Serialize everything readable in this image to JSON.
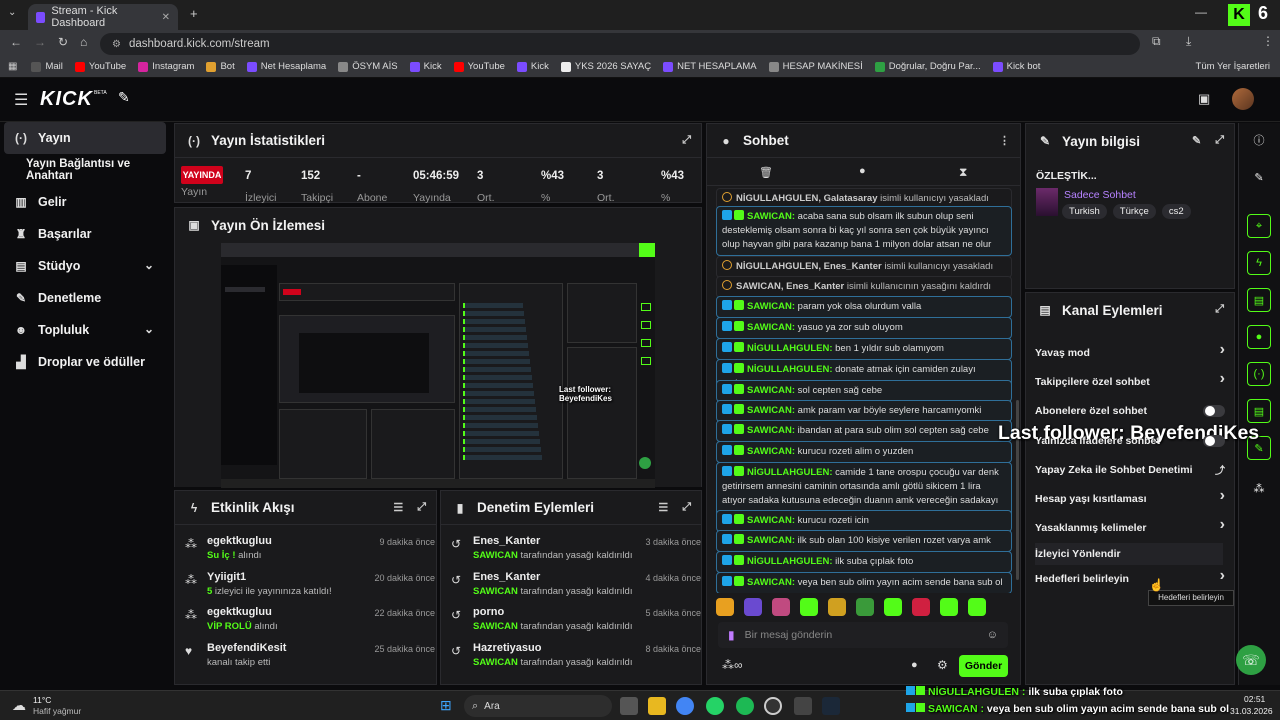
{
  "browser": {
    "tab_title": "Stream - Kick Dashboard",
    "url": "dashboard.kick.com/stream",
    "bookmarks": [
      "Mail",
      "YouTube",
      "Instagram",
      "Bot",
      "Net Hesaplama",
      "ÖSYM AİS",
      "Kick",
      "YouTube",
      "Kick",
      "YKS 2026 SAYAÇ",
      "NET HESAPLAMA",
      "HESAP MAKİNESİ",
      "Doğrular, Doğru Par...",
      "Kick bot"
    ],
    "bookmarks_all": "Tüm Yer İşaretleri",
    "bookmark_colors": [
      "#555",
      "#ff0000",
      "#d6249f",
      "#e0a030",
      "#7b4cff",
      "#888",
      "#7b4cff",
      "#ff0000",
      "#7b4cff",
      "#eee",
      "#7b4cff",
      "#888",
      "#2ea043",
      "#7b4cff"
    ]
  },
  "header": {
    "logo": "KICK",
    "beta": "BETA"
  },
  "sidebar": {
    "items": [
      {
        "label": "Yayın",
        "icon": "broadcast-icon"
      },
      {
        "label": "Yayın Bağlantısı ve Anahtarı",
        "icon": ""
      },
      {
        "label": "Gelir",
        "icon": "chart-icon"
      },
      {
        "label": "Başarılar",
        "icon": "trophy-icon"
      },
      {
        "label": "Stüdyo",
        "icon": "studio-icon"
      },
      {
        "label": "Denetleme",
        "icon": "wrench-icon"
      },
      {
        "label": "Topluluk",
        "icon": "people-icon"
      },
      {
        "label": "Droplar ve ödüller",
        "icon": "gift-icon"
      }
    ]
  },
  "stats": {
    "title": "Yayın İstatistikleri",
    "live_badge": "YAYINDA",
    "live_label": "Yayın",
    "columns": [
      {
        "value": "7",
        "label": "İzleyici"
      },
      {
        "value": "152",
        "label": "Takipçi"
      },
      {
        "value": "-",
        "label": "Abone"
      },
      {
        "value": "05:46:59",
        "label": "Yayında"
      },
      {
        "value": "3",
        "label": "Ort."
      },
      {
        "value": "%43",
        "label": "%"
      },
      {
        "value": "3",
        "label": "Ort."
      },
      {
        "value": "%43",
        "label": "%"
      }
    ]
  },
  "preview": {
    "title": "Yayın Ön İzlemesi",
    "overlay_text": "Last follower: BeyefendiKes"
  },
  "activity": {
    "title": "Etkinlik Akışı",
    "items": [
      {
        "name": "egektkugluu",
        "detail_b": "Su İç !",
        "detail": " alındı",
        "time": "9 dakika önce"
      },
      {
        "name": "Yyiigit1",
        "detail_b": "5",
        "detail": " izleyici ile yayınınıza katıldı!",
        "time": "20 dakika önce"
      },
      {
        "name": "egektkugluu",
        "detail_b": "VİP ROLÜ",
        "detail": " alındı",
        "time": "22 dakika önce"
      },
      {
        "name": "BeyefendiKesit",
        "detail_b": "",
        "detail": "kanalı takip etti",
        "time": "25 dakika önce"
      }
    ]
  },
  "moderation": {
    "title": "Denetim Eylemleri",
    "items": [
      {
        "name": "Enes_Kanter",
        "detail_b": "SAWICAN",
        "detail": " tarafından yasağı kaldırıldı",
        "time": "3 dakika önce"
      },
      {
        "name": "Enes_Kanter",
        "detail_b": "SAWICAN",
        "detail": " tarafından yasağı kaldırıldı",
        "time": "4 dakika önce"
      },
      {
        "name": "porno",
        "detail_b": "SAWICAN",
        "detail": " tarafından yasağı kaldırıldı",
        "time": "5 dakika önce"
      },
      {
        "name": "Hazretiyasuo",
        "detail_b": "SAWICAN",
        "detail": " tarafından yasağı kaldırıldı",
        "time": "8 dakika önce"
      }
    ]
  },
  "chat": {
    "title": "Sohbet",
    "messages": [
      {
        "type": "sys",
        "user": "NİGULLAHGULEN, Galatasaray",
        "text": " isimli kullanıcıyı yasakladı"
      },
      {
        "type": "msg",
        "user": "SAWICAN:",
        "text": " acaba sana sub olsam ilk subun olup seni desteklemiş olsam sonra bi kaç yıl sonra sen çok büyük yayıncı olup hayvan gibi para kazanıp bana 1 milyon dolar atsan ne olur"
      },
      {
        "type": "sys",
        "user": "NİGULLAHGULEN, Enes_Kanter",
        "text": " isimli kullanıcıyı yasakladı"
      },
      {
        "type": "sys",
        "user": "SAWICAN, Enes_Kanter",
        "text": " isimli kullanıcının yasağını kaldırdı"
      },
      {
        "type": "msg",
        "user": "SAWICAN:",
        "text": " param yok olsa olurdum valla"
      },
      {
        "type": "msg",
        "user": "SAWICAN:",
        "text": " yasuo ya zor sub oluyom"
      },
      {
        "type": "msg",
        "user": "NİGULLAHGULEN:",
        "text": " ben 1 yıldır sub olamıyom"
      },
      {
        "type": "msg",
        "user": "NİGULLAHGULEN:",
        "text": " donate atmak için camiden zulayı patlattım"
      },
      {
        "type": "msg",
        "user": "SAWICAN:",
        "text": " sol cepten sağ cebe"
      },
      {
        "type": "msg",
        "user": "SAWICAN:",
        "text": " amk param var böyle seylere harcamıyomki"
      },
      {
        "type": "msg",
        "user": "SAWICAN:",
        "text": " ibandan at para sub olim sol cepten sağ cebe"
      },
      {
        "type": "msg",
        "user": "SAWICAN:",
        "text": " kurucu rozeti alim o yuzden"
      },
      {
        "type": "msg",
        "user": "NİGULLAHGULEN:",
        "text": " camide 1 tane orospu çocuğu var denk getirirsem annesini caminin ortasında amlı götlü sikicem 1 lira atıyor sadaka kutusuna edeceğin duanın amk vereceğin sadakayı sikim"
      },
      {
        "type": "msg",
        "user": "SAWICAN:",
        "text": " kurucu rozeti icin"
      },
      {
        "type": "msg",
        "user": "SAWICAN:",
        "text": " ilk sub olan 100 kisiye verilen rozet varya amk"
      },
      {
        "type": "msg",
        "user": "NİGULLAHGULEN:",
        "text": " ilk suba çıplak foto"
      },
      {
        "type": "msg",
        "user": "SAWICAN:",
        "text": " veya ben sub olim yayın acim sende bana sub ol"
      }
    ],
    "input_placeholder": "Bir mesaj gönderin",
    "send_label": "Gönder"
  },
  "stream_info": {
    "title": "Yayın bilgisi",
    "stream_title": "ÖZLEŞTİK...",
    "category": "Sadece Sohbet",
    "tags": [
      "Turkish",
      "Türkçe",
      "cs2"
    ]
  },
  "channel_actions": {
    "title": "Kanal Eylemleri",
    "items": [
      {
        "label": "Yavaş mod",
        "control": "arrow"
      },
      {
        "label": "Takipçilere özel sohbet",
        "control": "arrow"
      },
      {
        "label": "Abonelere özel sohbet",
        "control": "toggle"
      },
      {
        "label": "Yalnızca ifadelere sohbet",
        "control": "toggle"
      },
      {
        "label": "Yapay Zeka ile Sohbet Denetimi",
        "control": "external"
      },
      {
        "label": "Hesap yaşı kısıtlaması",
        "control": "arrow"
      },
      {
        "label": "Yasaklanmış kelimeler",
        "control": "arrow"
      },
      {
        "label": "İzleyici Yönlendir",
        "control": "none"
      },
      {
        "label": "Hedefleri belirleyin",
        "control": "arrow"
      }
    ],
    "tooltip": "Hedefleri belirleyin"
  },
  "overlay": {
    "follower": "Last follower: BeyefendiKes",
    "chat_line1_user": "NİGULLAHGULEN :",
    "chat_line1_text": " ilk suba çıplak foto",
    "chat_line2_user": "SAWICAN :",
    "chat_line2_text": " veya ben sub olim yayın acim sende bana sub ol"
  },
  "taskbar": {
    "weather_temp": "11°C",
    "weather_desc": "Hafif yağmur",
    "search": "Ara",
    "time": "02:51",
    "date": "31.03.2026"
  },
  "colors": {
    "accent": "#53fc18",
    "live": "#d0021b",
    "chat_border": "#2f6f99"
  }
}
